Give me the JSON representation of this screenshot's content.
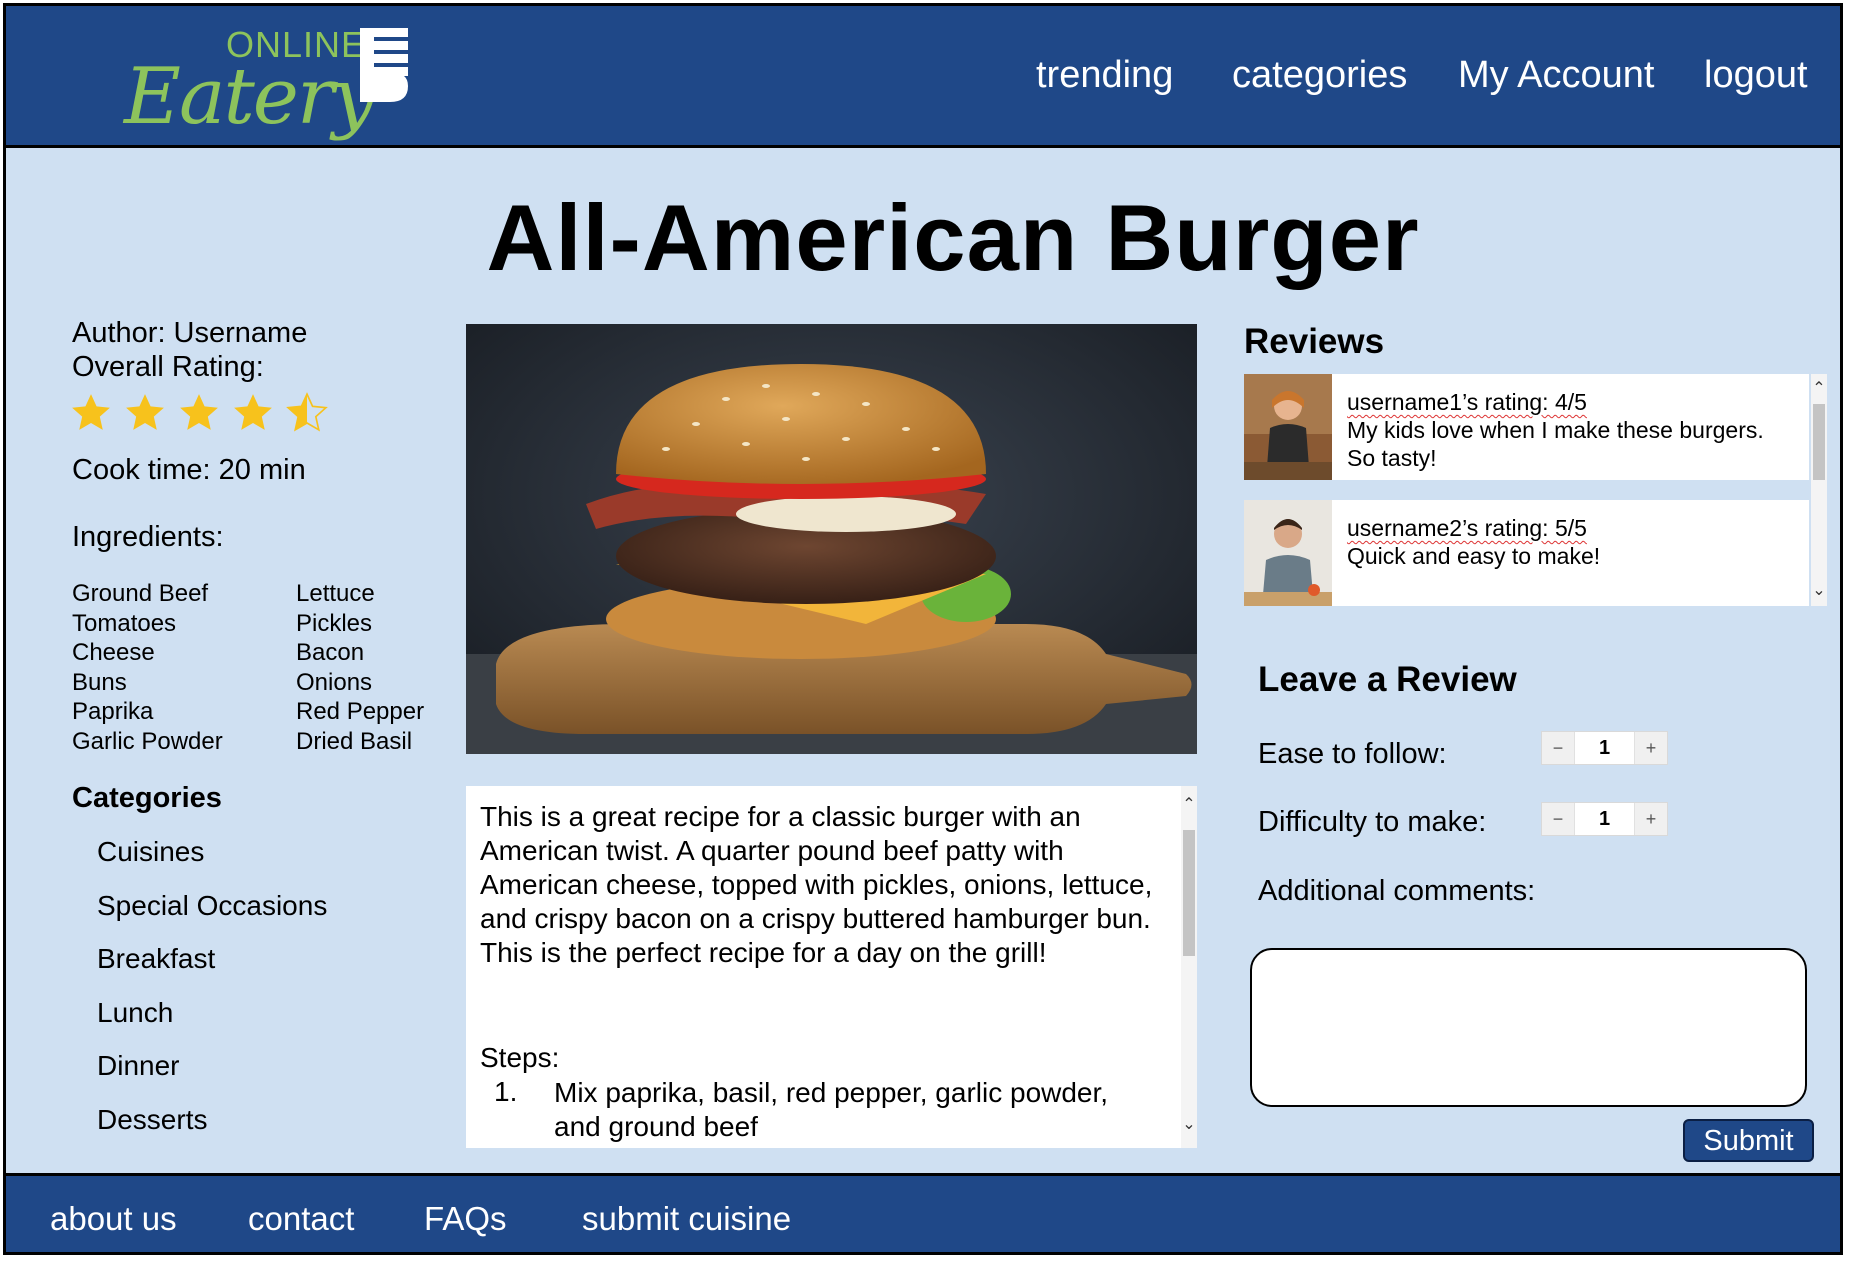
{
  "header": {
    "logo": {
      "top_text": "ONLINE",
      "script_text": "Eatery"
    },
    "nav": [
      "trending",
      "categories",
      "My Account",
      "logout"
    ]
  },
  "recipe": {
    "title": "All-American Burger",
    "author": "Author: Username",
    "rating_label": "Overall Rating:",
    "rating_value": 4.5,
    "rating_max": 5,
    "cook_time": "Cook time: 20 min",
    "ingredients_label": "Ingredients:",
    "ingredients_col1": [
      "Ground Beef",
      "Tomatoes",
      "Cheese",
      "Buns",
      "Paprika",
      "Garlic Powder"
    ],
    "ingredients_col2": [
      "Lettuce",
      "Pickles",
      "Bacon",
      "Onions",
      "Red Pepper",
      "Dried Basil"
    ],
    "description": "This is a great recipe for a classic burger with an American twist. A quarter pound beef patty with American cheese, topped with pickles, onions, lettuce, and crispy bacon on a crispy buttered hamburger bun. This is the perfect recipe for a day on the grill!",
    "steps_label": "Steps:",
    "steps": [
      {
        "num": "1.",
        "text": "Mix paprika, basil, red pepper, garlic powder, and ground beef"
      }
    ]
  },
  "categories": {
    "heading": "Categories",
    "items": [
      "Cuisines",
      "Special Occasions",
      "Breakfast",
      "Lunch",
      "Dinner",
      "Desserts"
    ]
  },
  "reviews": {
    "heading": "Reviews",
    "items": [
      {
        "rating": "username1’s rating: 4/5",
        "body": "My kids love when I make these burgers. So tasty!"
      },
      {
        "rating": "username2’s rating: 5/5",
        "body": "Quick and easy to make!"
      }
    ]
  },
  "leave_review": {
    "heading": "Leave a Review",
    "ease_label": "Ease to follow:",
    "ease_value": "1",
    "difficulty_label": "Difficulty to make:",
    "difficulty_value": "1",
    "comments_label": "Additional comments:",
    "comments_value": "",
    "submit_label": "Submit",
    "stepper_minus": "−",
    "stepper_plus": "+"
  },
  "footer": {
    "links": [
      "about us",
      "contact",
      "FAQs",
      "submit cuisine"
    ]
  },
  "colors": {
    "brand_blue": "#1f4888",
    "page_bg": "#cfe0f2",
    "logo_green": "#8dc35c",
    "star_yellow": "#f7c21c"
  }
}
